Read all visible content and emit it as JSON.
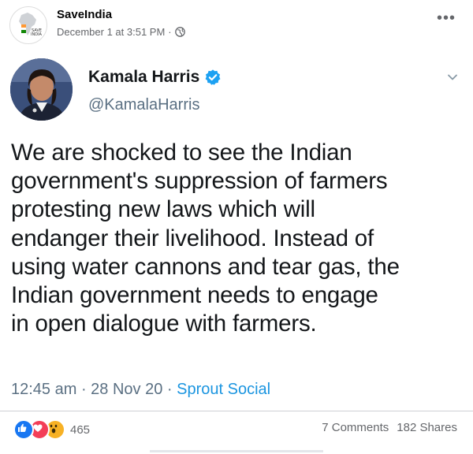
{
  "post": {
    "page_name": "SaveIndia",
    "timestamp": "December 1 at 3:51 PM",
    "separator": "·",
    "privacy_icon": "globe-icon",
    "more_icon": "more-options-icon",
    "more_label": "•••"
  },
  "tweet": {
    "author_name": "Kamala Harris",
    "verified_icon": "verified-badge-icon",
    "handle": "@KamalaHarris",
    "text": "We are shocked to see the Indian\ngovernment's suppression of farmers\nprotesting new laws which will\nendanger their livelihood. Instead of\nusing water cannons and tear gas, the\nIndian government needs to engage\nin open dialogue with farmers.",
    "time": "12:45 am",
    "date": "28 Nov 20",
    "source": "Sprout Social"
  },
  "engagement": {
    "reaction_icons": [
      "like-icon",
      "love-icon",
      "wow-icon"
    ],
    "reaction_count": "465",
    "comments": "7 Comments",
    "shares": "182 Shares"
  },
  "colors": {
    "facebook_blue": "#1877f2",
    "love_red": "#f33e58",
    "wow_yellow": "#f7b125",
    "twitter_link": "#1b95e0",
    "muted_text": "#65676b"
  }
}
